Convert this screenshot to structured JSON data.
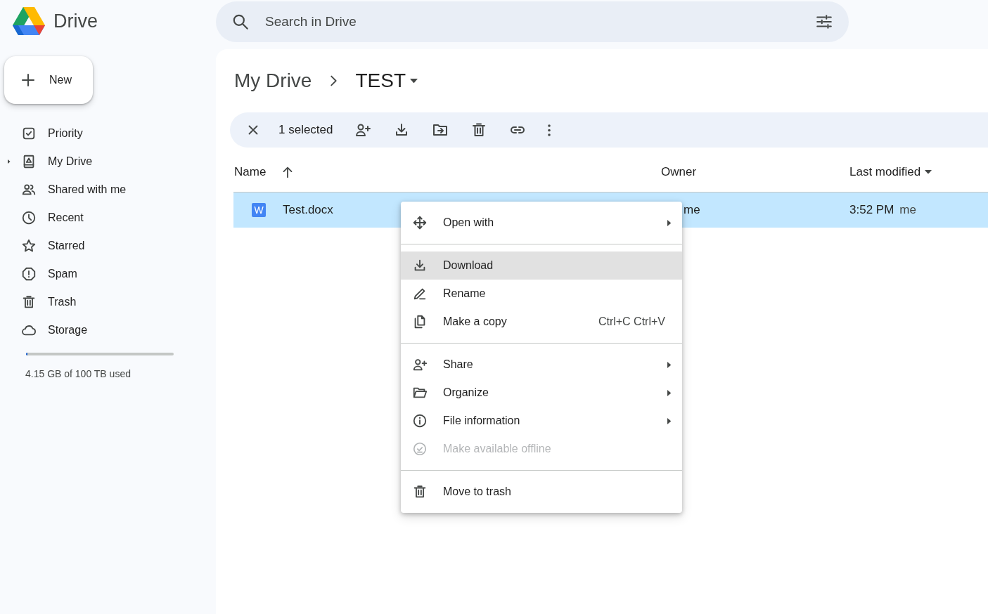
{
  "app": {
    "name": "Drive"
  },
  "search": {
    "placeholder": "Search in Drive"
  },
  "new_button": {
    "label": "New"
  },
  "sidebar": {
    "items": [
      {
        "label": "Priority",
        "selected": false
      },
      {
        "label": "My Drive",
        "selected": false,
        "expanded": false
      },
      {
        "label": "Shared with me",
        "selected": false
      },
      {
        "label": "Recent",
        "selected": false
      },
      {
        "label": "Starred",
        "selected": false
      },
      {
        "label": "Spam",
        "selected": false
      },
      {
        "label": "Trash",
        "selected": false
      },
      {
        "label": "Storage",
        "selected": false
      }
    ]
  },
  "storage": {
    "level": 0.01,
    "text": "4.15 GB of 100 TB used"
  },
  "breadcrumb": [
    {
      "label": "My Drive",
      "dropdown": false
    },
    {
      "label": "TEST",
      "dropdown": true
    }
  ],
  "selection_bar": {
    "count": "1 selected"
  },
  "table": {
    "columns": [
      {
        "label": "Name",
        "sorted": true,
        "dropdown": false
      },
      {
        "label": "Owner",
        "sorted": false,
        "dropdown": false
      },
      {
        "label": "Last modified",
        "sorted": false,
        "dropdown": true
      }
    ],
    "rows": [
      {
        "badge": "W",
        "name": "Test.docx",
        "owner": "me",
        "modified": "3:52 PM",
        "modified_by": "me",
        "selected": true
      }
    ]
  },
  "context_menu": {
    "groups": [
      [
        {
          "label": "Open with",
          "highlighted": false,
          "disabled": false,
          "submenu": true
        }
      ],
      [
        {
          "label": "Download",
          "highlighted": true,
          "disabled": false,
          "submenu": false
        },
        {
          "label": "Rename",
          "highlighted": false,
          "disabled": false,
          "submenu": false
        },
        {
          "label": "Make a copy",
          "shortcut": "Ctrl+C Ctrl+V",
          "highlighted": false,
          "disabled": false,
          "submenu": false
        }
      ],
      [
        {
          "label": "Share",
          "highlighted": false,
          "disabled": false,
          "submenu": true
        },
        {
          "label": "Organize",
          "highlighted": false,
          "disabled": false,
          "submenu": true
        },
        {
          "label": "File information",
          "highlighted": false,
          "disabled": false,
          "submenu": true
        },
        {
          "label": "Make available offline",
          "highlighted": false,
          "disabled": true,
          "submenu": false
        }
      ],
      [
        {
          "label": "Move to trash",
          "highlighted": false,
          "disabled": false,
          "submenu": false
        }
      ]
    ]
  }
}
